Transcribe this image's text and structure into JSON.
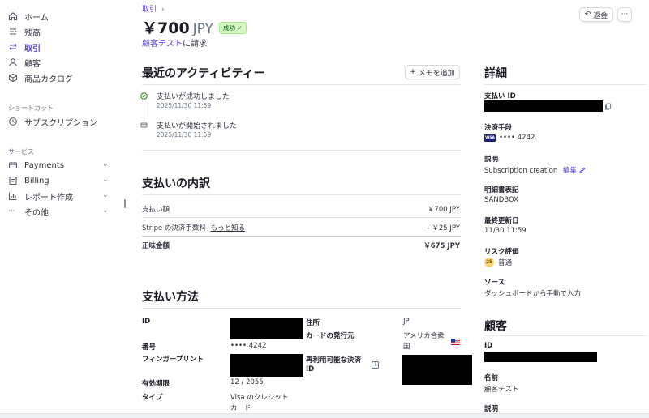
{
  "sidebar": {
    "items": [
      {
        "label": "ホーム",
        "icon": "home-icon"
      },
      {
        "label": "残高",
        "icon": "balance-icon"
      },
      {
        "label": "取引",
        "icon": "transactions-icon"
      },
      {
        "label": "顧客",
        "icon": "customer-icon"
      },
      {
        "label": "商品カタログ",
        "icon": "product-catalog-icon"
      }
    ],
    "shortcuts_title": "ショートカット",
    "shortcuts": [
      {
        "label": "サブスクリプション",
        "icon": "subscription-icon"
      }
    ],
    "services_title": "サービス",
    "services": [
      {
        "label": "Payments",
        "icon": "payments-icon"
      },
      {
        "label": "Billing",
        "icon": "billing-icon"
      },
      {
        "label": "レポート作成",
        "icon": "reports-icon"
      },
      {
        "label": "その他",
        "icon": "more-icon"
      }
    ]
  },
  "header": {
    "breadcrumb": "取引",
    "breadcrumb_chevron": "›",
    "amount": "￥700",
    "currency": "JPY",
    "status_badge": "成功",
    "status_check": "✓",
    "customer_link": "顧客テスト",
    "charge_suffix": "に請求",
    "refund_icon": "↶",
    "refund_button": "返金",
    "more_button": "···"
  },
  "activity": {
    "title": "最近のアクティビティー",
    "add_memo_icon": "+",
    "add_memo_button": "メモを追加",
    "events": [
      {
        "title": "支払いが成功しました",
        "time": "2025/11/30 11:59"
      },
      {
        "title": "支払いが開始されました",
        "time": "2025/11/30 11:59"
      }
    ]
  },
  "breakdown": {
    "title": "支払いの内訳",
    "rows": [
      {
        "label": "支払い額",
        "value": "￥700 JPY"
      },
      {
        "label": "Stripe の決済手数料",
        "link": "もっと知る",
        "value": "- ￥25 JPY"
      }
    ],
    "net_label": "正味金額",
    "net_value": "￥675 JPY"
  },
  "payment_method": {
    "title": "支払い方法",
    "id_label": "ID",
    "number_label": "番号",
    "number_value": "•••• 4242",
    "fingerprint_label": "フィンガープリント",
    "expiry_label": "有効期限",
    "expiry_value": "12 / 2055",
    "type_label": "タイプ",
    "type_value_line1": "Visa のクレジット",
    "type_value_line2": "カード",
    "address_label": "住所",
    "address_value": "JP",
    "issuer_label": "カードの発行元",
    "issuer_value_line1": "アメリカ合衆",
    "issuer_value_line2": "国",
    "reusable_label_line1": "再利用可能な決済",
    "reusable_label_line2": "ID",
    "info_icon": "i"
  },
  "details": {
    "title": "詳細",
    "payment_id_label": "支払い ID",
    "method_label": "決済手段",
    "method_brand": "VISA",
    "method_value": "•••• 4242",
    "description_label": "説明",
    "description_value": "Subscription creation",
    "edit_link": "編集",
    "statement_label": "明細書表記",
    "statement_value": "SANDBOX",
    "updated_label": "最終更新日",
    "updated_value": "11/30 11:59",
    "risk_label": "リスク評価",
    "risk_score": "25",
    "risk_value": "普通",
    "source_label": "ソース",
    "source_value": "ダッシュボードから手動で入力"
  },
  "customer": {
    "title": "顧客",
    "id_label": "ID",
    "name_label": "名前",
    "name_value": "顧客テスト",
    "description_label": "説明"
  },
  "colors": {
    "accent": "#5b49d6",
    "success_bg": "#d7f7c2",
    "success_text": "#05690d",
    "risk_badge": "#fcd579"
  }
}
